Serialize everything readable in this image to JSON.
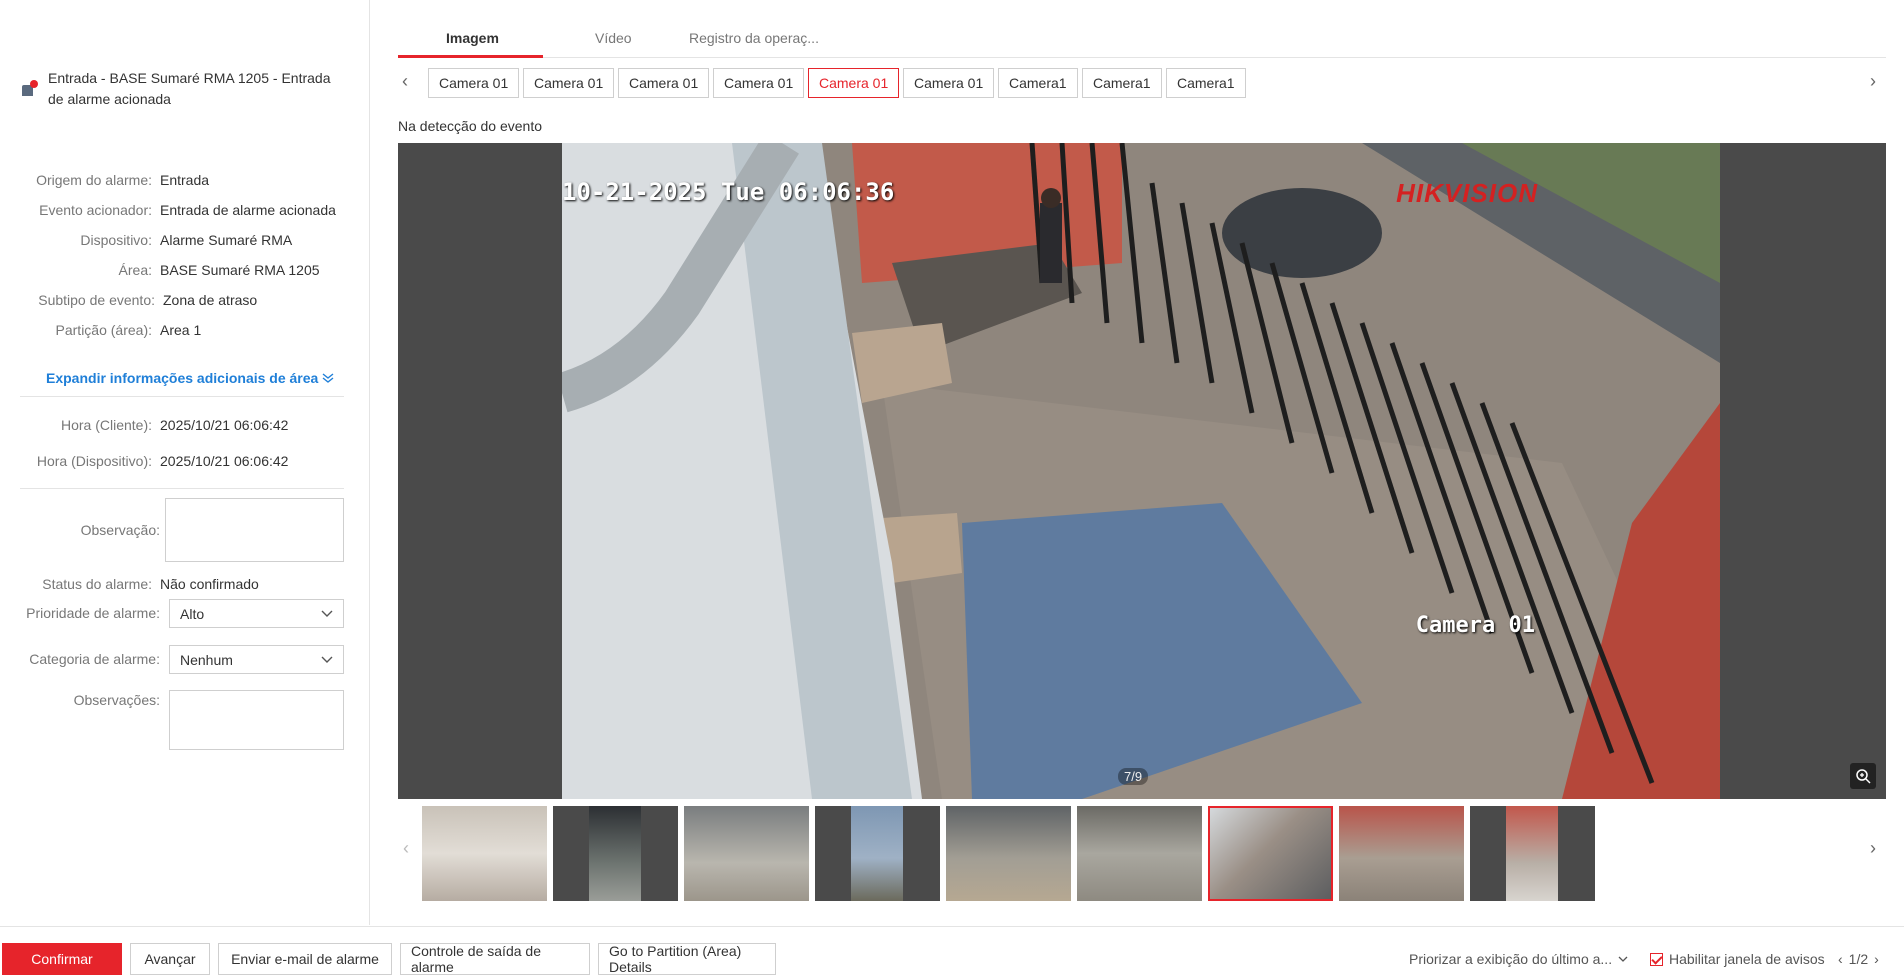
{
  "alarm": {
    "title": "Entrada - BASE Sumaré RMA 1205 - Entrada de alarme acionada"
  },
  "details": {
    "origin_label": "Origem do alarme:",
    "origin_value": "Entrada",
    "trigger_label": "Evento acionador:",
    "trigger_value": "Entrada de alarme acionada",
    "device_label": "Dispositivo:",
    "device_value": "Alarme Sumaré RMA",
    "area_label": "Área:",
    "area_value": "BASE Sumaré RMA 1205",
    "subtype_label": "Subtipo de evento:",
    "subtype_value": "Zona de atraso",
    "partition_label": "Partição (área):",
    "partition_value": "Area 1",
    "expand_label": "Expandir informações adicionais de área",
    "client_time_label": "Hora (Cliente):",
    "client_time_value": "2025/10/21 06:06:42",
    "device_time_label": "Hora (Dispositivo):",
    "device_time_value": "2025/10/21 06:06:42",
    "observation_label": "Observação:",
    "status_label": "Status do alarme:",
    "status_value": "Não confirmado",
    "priority_label": "Prioridade de alarme:",
    "priority_value": "Alto",
    "category_label": "Categoria de alarme:",
    "category_value": "Nenhum",
    "remarks_label": "Observações:"
  },
  "tabs": [
    "Imagem",
    "Vídeo",
    "Registro da operaç..."
  ],
  "cameras": [
    "Camera 01",
    "Camera 01",
    "Camera 01",
    "Camera 01",
    "Camera 01",
    "Camera 01",
    "Camera1",
    "Camera1",
    "Camera1"
  ],
  "active_camera_index": 4,
  "detection_label": "Na detecção do evento",
  "image": {
    "osd_time": "10-21-2025 Tue 06:06:36",
    "osd_brand": "HIKVISION",
    "osd_camera": "Camera 01",
    "counter": "7/9"
  },
  "thumbnails_count": 9,
  "active_thumbnail_index": 6,
  "footer": {
    "confirm": "Confirmar",
    "forward": "Avançar",
    "email": "Enviar e-mail de alarme",
    "output": "Controle de saída de alarme",
    "partition": "Go to Partition (Area) Details",
    "prioritize": "Priorizar a exibição do último a...",
    "popup": "Habilitar janela de avisos",
    "page": "1/2"
  },
  "colors": {
    "accent": "#e6242b",
    "link": "#1f7fd8"
  },
  "icons": [
    "alarm-input-icon",
    "chevron-left-icon",
    "chevron-right-icon",
    "chevron-down-icon",
    "double-chevron-down-icon",
    "zoom-in-icon",
    "checkbox-checked-icon"
  ]
}
